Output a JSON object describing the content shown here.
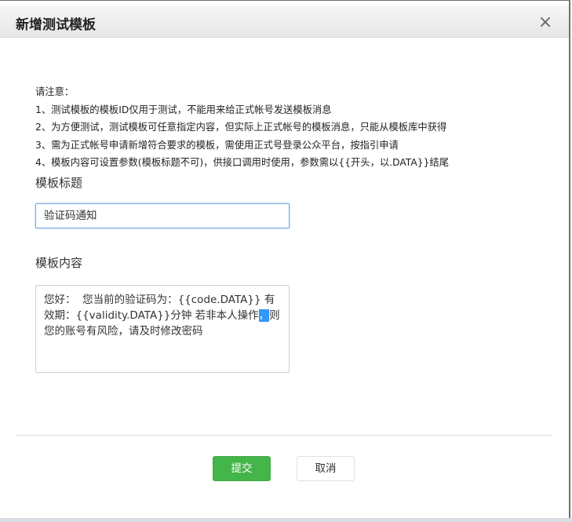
{
  "dialog": {
    "title": "新增测试模板",
    "close_icon": "×"
  },
  "notes": [
    "请注意：",
    "1、测试模板的模板ID仅用于测试，不能用来给正式帐号发送模板消息",
    "2、为方便测试，测试模板可任意指定内容，但实际上正式帐号的模板消息，只能从模板库中获得",
    "3、需为正式帐号申请新增符合要求的模板，需使用正式号登录公众平台，按指引申请",
    "4、模板内容可设置参数(模板标题不可)，供接口调用时使用，参数需以{{开头，以.DATA}}结尾"
  ],
  "form": {
    "title_label": "模板标题",
    "title_value": "验证码通知",
    "content_label": "模板内容",
    "content_before": "您好：  您当前的验证码为：{{code.DATA}} 有效期：{{validity.DATA}}分钟 若非本人操作",
    "content_selected": "，",
    "content_after": "则您的账号有风险，请及时修改密码"
  },
  "buttons": {
    "submit": "提交",
    "cancel": "取消"
  },
  "colors": {
    "primary_green": "#44b549",
    "focus_border": "#6fa6de",
    "selection": "#3296fa"
  }
}
